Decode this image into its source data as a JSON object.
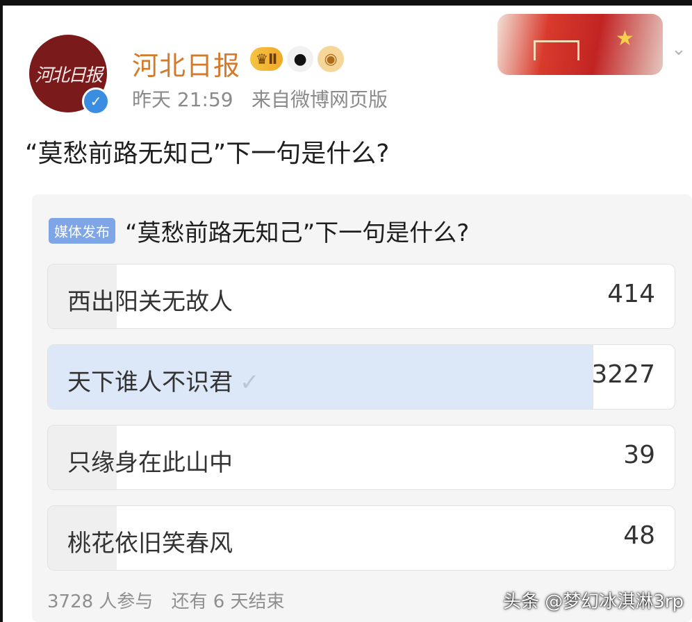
{
  "author": {
    "name": "河北日报",
    "avatar_text": "河北日报",
    "level_badge": "Ⅱ",
    "time": "昨天 21:59",
    "source": "来自微博网页版"
  },
  "post": {
    "text": "“莫愁前路无知己”下一句是什么?"
  },
  "poll": {
    "tag": "媒体发布",
    "title": "“莫愁前路无知己”下一句是什么?",
    "options": [
      {
        "label": "西出阳关无故人",
        "count": "414",
        "share": 0.11,
        "selected": false
      },
      {
        "label": "天下谁人不识君",
        "count": "3227",
        "share": 0.87,
        "selected": true
      },
      {
        "label": "只缘身在此山中",
        "count": "39",
        "share": 0.01,
        "selected": false
      },
      {
        "label": "桃花依旧笑春风",
        "count": "48",
        "share": 0.01,
        "selected": false
      }
    ],
    "participants": "3728 人参与",
    "remaining": "还有 6 天结束"
  },
  "watermark": "头条 @梦幻冰淇淋3rp",
  "icons": [
    "verified-icon",
    "crown-badge-icon",
    "panda-badge-icon",
    "fish-badge-icon",
    "chevron-down-icon",
    "check-icon"
  ],
  "colors": {
    "username": "#d57a2a",
    "selected_fill": "#dce8f8",
    "media_tag": "#7ea6e6"
  }
}
